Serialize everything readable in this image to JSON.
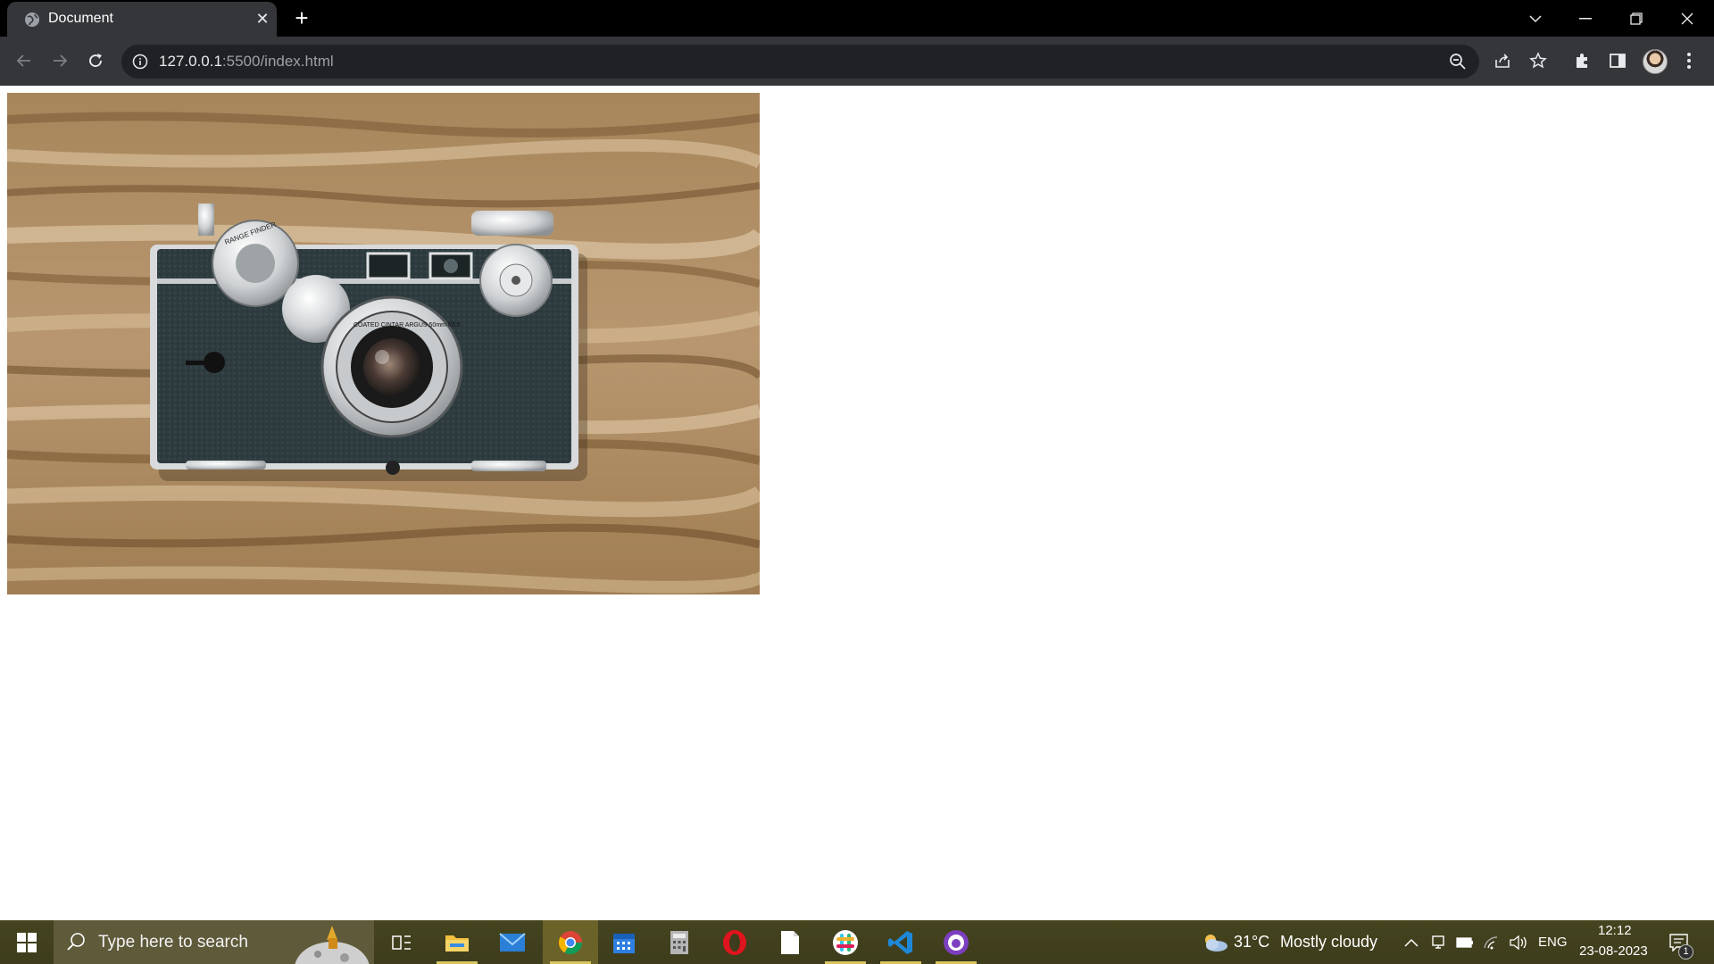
{
  "browser": {
    "tab_title": "Document",
    "tab_close": "✕",
    "new_tab": "+",
    "url_host": "127.0.0.1",
    "url_rest": ":5500/index.html"
  },
  "page": {
    "image_alt": "vintage rangefinder camera on wooden table",
    "camera_dial_text": "RANGE FINDER",
    "lens_text": "COATED CINTAR ARGUS 50mm f/3.5"
  },
  "taskbar": {
    "search_placeholder": "Type here to search",
    "weather_temp": "31°C",
    "weather_desc": "Mostly cloudy",
    "language": "ENG",
    "time": "12:12",
    "date": "23-08-2023",
    "notification_count": "1"
  },
  "colors": {
    "chrome_dark": "#000000",
    "toolbar": "#35363a",
    "omnibox": "#202124",
    "taskbar": "#3d3c1c",
    "wood": "#b08d62"
  }
}
